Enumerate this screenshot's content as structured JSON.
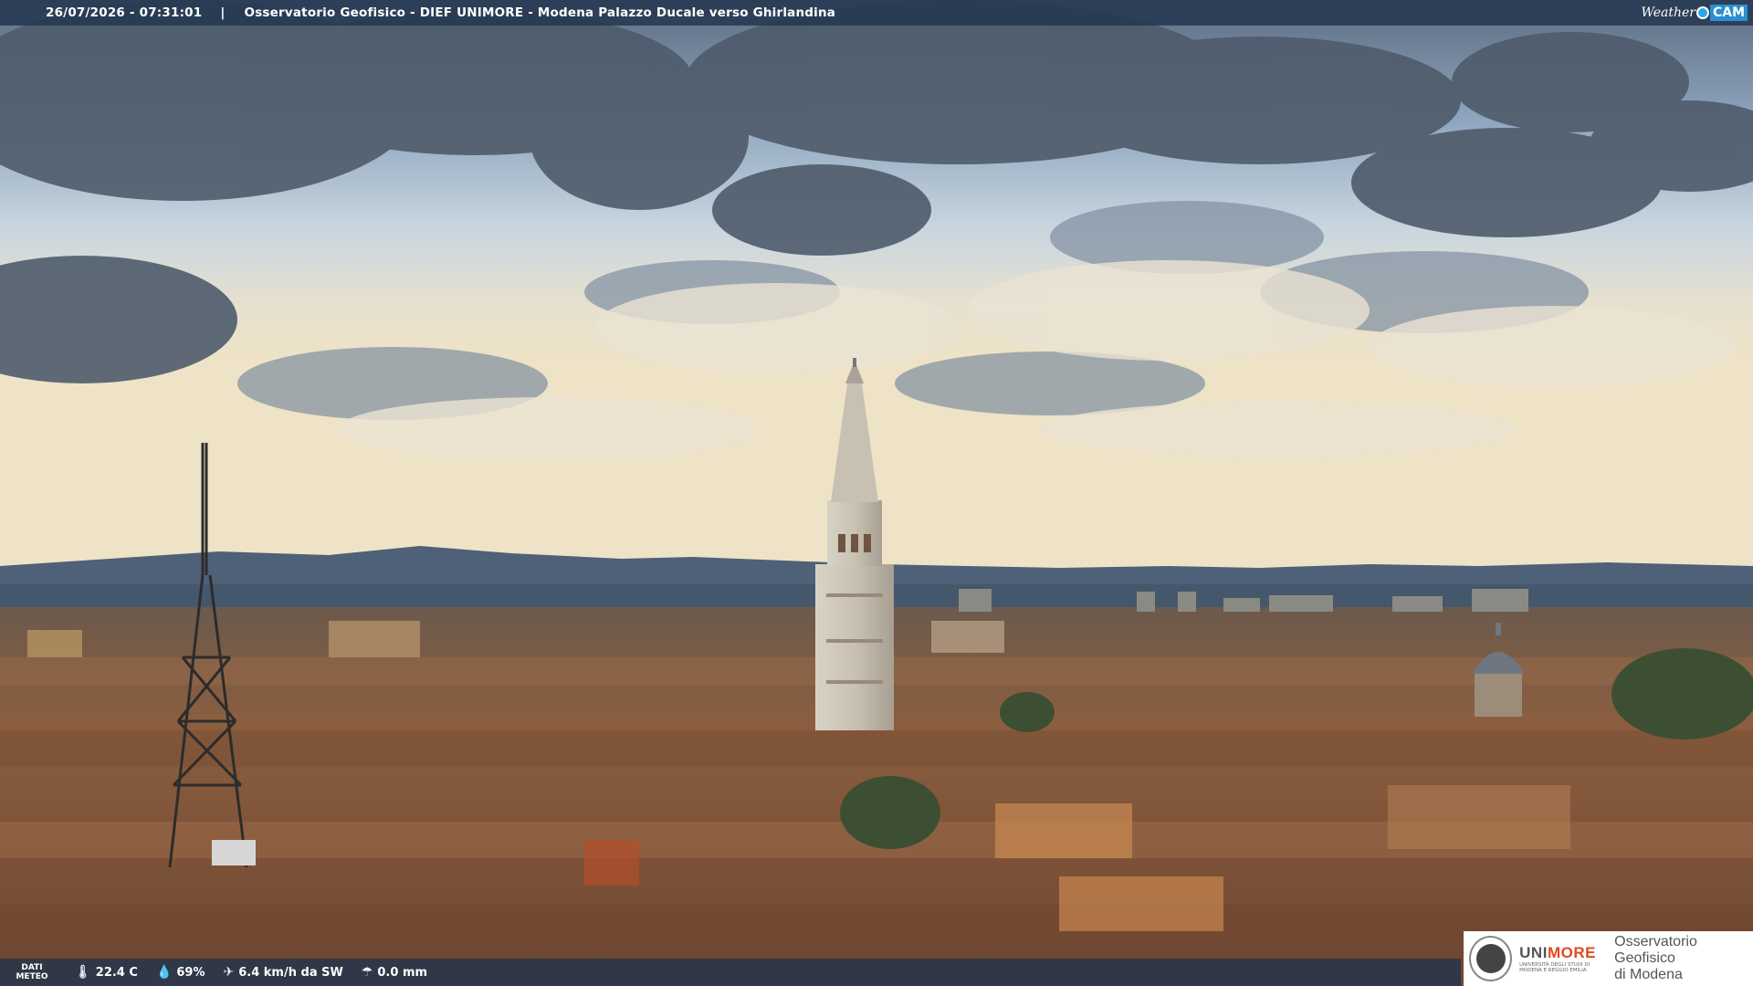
{
  "overlay": {
    "timestamp": "26/07/2026 - 07:31:01",
    "separator": "|",
    "caption": "Osservatorio Geofisico - DIEF UNIMORE - Modena Palazzo Ducale verso Ghirlandina"
  },
  "brand_logo": {
    "weather": "Weather",
    "cam": "CAM"
  },
  "weather": {
    "label_line1": "DATI",
    "label_line2": "METEO",
    "temperature": "22.4 C",
    "humidity": "69%",
    "wind": "6.4 km/h da SW",
    "rain": "0.0 mm",
    "icons": [
      "thermometer-icon",
      "humidity-drop-icon",
      "wind-icon",
      "rain-gauge-icon"
    ]
  },
  "institution": {
    "name_part1": "UNI",
    "name_part2": "MORE",
    "subtitle": "UNIVERSITÀ DEGLI STUDI DI MODENA E REGGIO EMILIA",
    "observatory_line1": "Osservatorio Geofisico",
    "observatory_line2": "di Modena"
  },
  "colors": {
    "sky_top": "#5f6e80",
    "cloud_dark": "#4c5866",
    "cloud_light": "#e8e2d4",
    "horizon": "#eadfc7",
    "mountains": "#4d6079",
    "roofs": "#8a5a3c",
    "accent_unimore": "#e04a1f",
    "bar": "#22344e"
  }
}
